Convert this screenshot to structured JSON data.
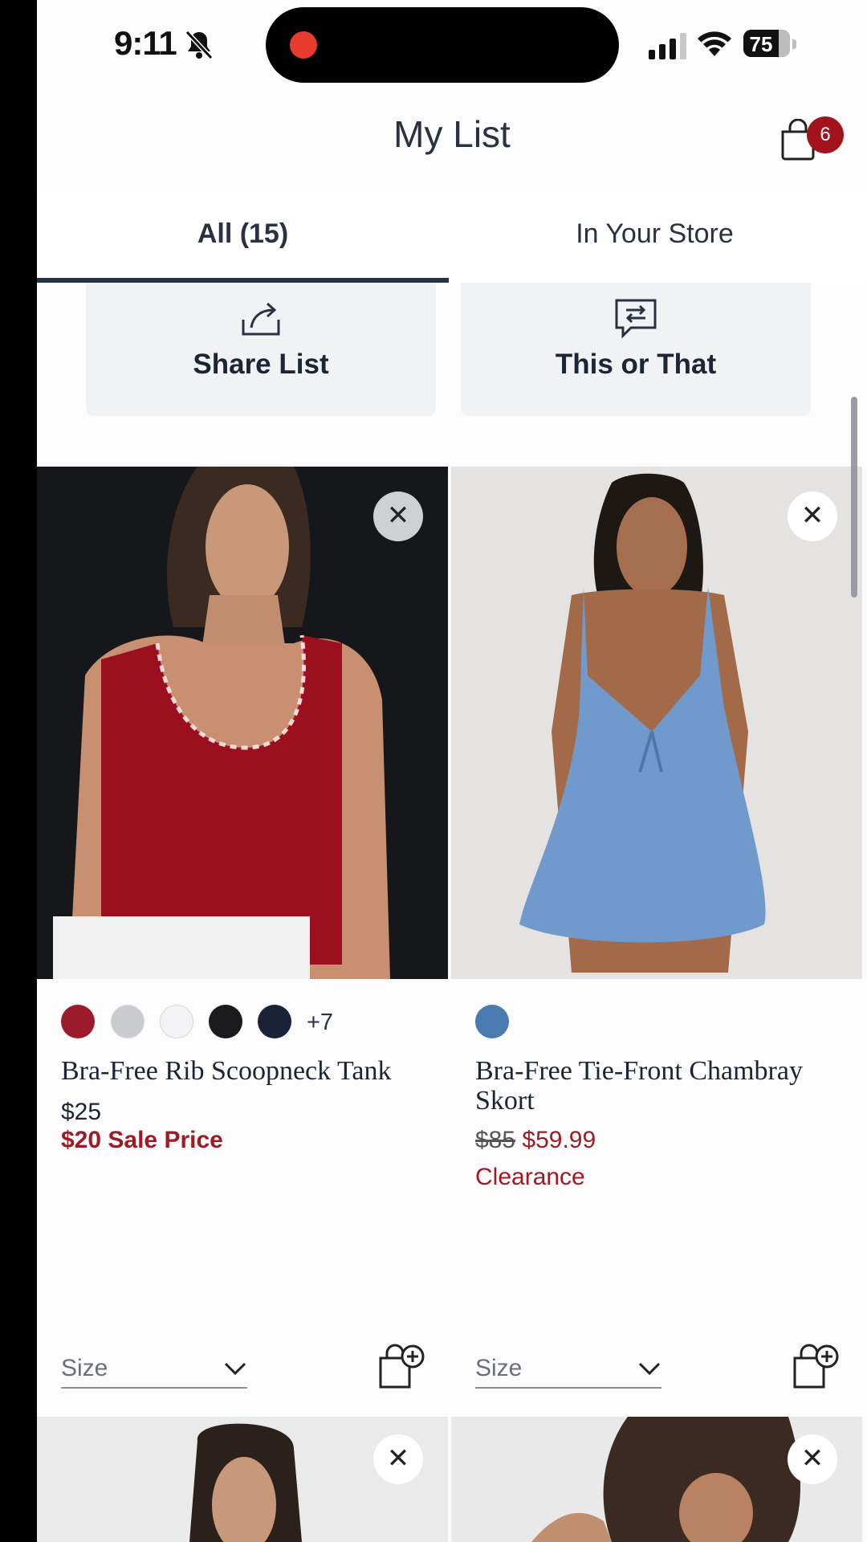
{
  "status_bar": {
    "time": "9:11",
    "battery_level": 75,
    "battery_label": "75"
  },
  "header": {
    "title": "My List",
    "cart_count": "6"
  },
  "tabs": [
    {
      "label": "All (15)",
      "active": true
    },
    {
      "label": "In Your Store",
      "active": false
    }
  ],
  "actions": [
    {
      "label": "Share List",
      "icon": "share-icon"
    },
    {
      "label": "This or That",
      "icon": "compare-chat-icon"
    }
  ],
  "products": [
    {
      "name": "Bra-Free Rib Scoopneck Tank",
      "swatches": [
        "#9b1b2c",
        "#c9cbcf",
        "#f3f3f5",
        "#1b1b1d",
        "#1a2238"
      ],
      "swatch_more": "+7",
      "price": "$25",
      "sale_price": "$20 Sale Price",
      "size_placeholder": "Size"
    },
    {
      "name": "Bra-Free Tie-Front Chambray Skort",
      "swatches": [
        "#4a7bb0"
      ],
      "original_price": "$85",
      "price": "$59.99",
      "status": "Clearance",
      "size_placeholder": "Size"
    }
  ],
  "colors": {
    "accent": "#a3131d",
    "navy": "#253248"
  }
}
